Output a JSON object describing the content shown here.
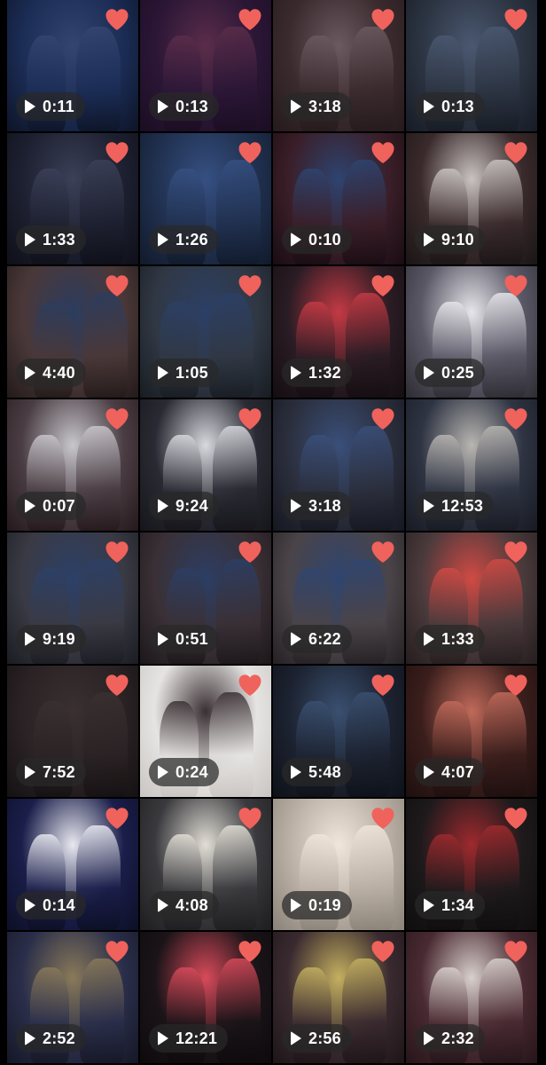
{
  "gallery": {
    "accent_heart_color": "#f0625c",
    "play_icon": "play-icon",
    "favorite_icon": "heart-icon",
    "videos": [
      {
        "duration": "0:11",
        "colors": [
          "#1b2c55",
          "#33466f",
          "#0d1426"
        ]
      },
      {
        "duration": "0:13",
        "colors": [
          "#2b1636",
          "#5a2d4a",
          "#1a0d22"
        ]
      },
      {
        "duration": "3:18",
        "colors": [
          "#3a2a2e",
          "#6b5a60",
          "#251a1c"
        ]
      },
      {
        "duration": "0:13",
        "colors": [
          "#2c3442",
          "#4a5870",
          "#161b24"
        ]
      },
      {
        "duration": "1:33",
        "colors": [
          "#1d2030",
          "#3c4058",
          "#0e0f18"
        ]
      },
      {
        "duration": "1:26",
        "colors": [
          "#20304f",
          "#365082",
          "#111a2b"
        ]
      },
      {
        "duration": "0:10",
        "colors": [
          "#3a1e28",
          "#2e4470",
          "#190c12"
        ]
      },
      {
        "duration": "9:10",
        "colors": [
          "#3a2a2c",
          "#c9c3c0",
          "#1a1516"
        ]
      },
      {
        "duration": "4:40",
        "colors": [
          "#4a3838",
          "#2c3c5e",
          "#231a1a"
        ]
      },
      {
        "duration": "1:05",
        "colors": [
          "#303844",
          "#2c3f66",
          "#181c22"
        ]
      },
      {
        "duration": "1:32",
        "colors": [
          "#2a1c24",
          "#c43a44",
          "#140d11"
        ]
      },
      {
        "duration": "0:25",
        "colors": [
          "#5a5866",
          "#e6e6ea",
          "#2d2c33"
        ]
      },
      {
        "duration": "0:07",
        "colors": [
          "#4a3e44",
          "#c8c6cc",
          "#25181c"
        ]
      },
      {
        "duration": "9:24",
        "colors": [
          "#2a2a34",
          "#d8d8de",
          "#15151a"
        ]
      },
      {
        "duration": "3:18",
        "colors": [
          "#2b2f3d",
          "#3a4f7a",
          "#151720"
        ]
      },
      {
        "duration": "12:53",
        "colors": [
          "#2f3443",
          "#b9b6b2",
          "#171a22"
        ]
      },
      {
        "duration": "9:19",
        "colors": [
          "#3a3a44",
          "#2c4068",
          "#1b1b22"
        ]
      },
      {
        "duration": "0:51",
        "colors": [
          "#3a3036",
          "#2c3e64",
          "#1c171a"
        ]
      },
      {
        "duration": "6:22",
        "colors": [
          "#4a4448",
          "#2f4570",
          "#242024"
        ]
      },
      {
        "duration": "1:33",
        "colors": [
          "#4a3a3c",
          "#d04a44",
          "#251d1e"
        ]
      },
      {
        "duration": "7:52",
        "colors": [
          "#2a2224",
          "#3a3032",
          "#151112"
        ]
      },
      {
        "duration": "0:24",
        "colors": [
          "#e6e4e2",
          "#3a3034",
          "#c8c4c2"
        ]
      },
      {
        "duration": "5:48",
        "colors": [
          "#1c2230",
          "#3a5070",
          "#0e1118"
        ]
      },
      {
        "duration": "4:07",
        "colors": [
          "#3a1e1c",
          "#c06a5a",
          "#1d0f0e"
        ]
      },
      {
        "duration": "0:14",
        "colors": [
          "#1a1e4a",
          "#e8e8f0",
          "#0d0f25"
        ]
      },
      {
        "duration": "4:08",
        "colors": [
          "#3a3a3e",
          "#e2ded6",
          "#1d1d1f"
        ]
      },
      {
        "duration": "0:19",
        "colors": [
          "#b8aea4",
          "#f0e6da",
          "#8a8278"
        ]
      },
      {
        "duration": "1:34",
        "colors": [
          "#1e1a1c",
          "#9e2a2e",
          "#0f0d0e"
        ]
      },
      {
        "duration": "2:52",
        "colors": [
          "#2a2e4a",
          "#8a7a5a",
          "#151725"
        ]
      },
      {
        "duration": "12:21",
        "colors": [
          "#1a1418",
          "#d84a5a",
          "#0d0a0c"
        ]
      },
      {
        "duration": "2:56",
        "colors": [
          "#3a2a30",
          "#c4b060",
          "#1d1518"
        ]
      },
      {
        "duration": "2:32",
        "colors": [
          "#4a2a32",
          "#d8d0cc",
          "#25151a"
        ]
      }
    ]
  }
}
